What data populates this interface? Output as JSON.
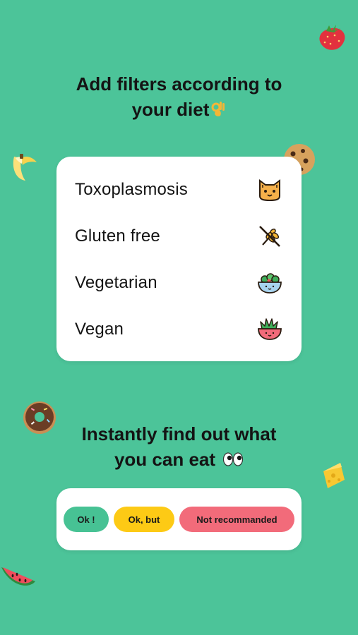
{
  "filters_section": {
    "title_line1": "Add filters according to",
    "title_line2": "your diet",
    "title_emoji": "ok-hand-emoji",
    "items": [
      {
        "label": "Toxoplasmosis",
        "icon": "cat-face-icon"
      },
      {
        "label": "Gluten free",
        "icon": "no-wheat-icon"
      },
      {
        "label": "Vegetarian",
        "icon": "salad-bowl-icon"
      },
      {
        "label": "Vegan",
        "icon": "plant-pot-icon"
      }
    ]
  },
  "results_section": {
    "title_line1": "Instantly find out what",
    "title_line2": "you can eat",
    "title_emoji": "eyes-emoji",
    "badges": [
      {
        "label": "Ok !",
        "color": "#47c294"
      },
      {
        "label": "Ok, but",
        "color": "#fdca15"
      },
      {
        "label": "Not recommanded",
        "color": "#f26b7a"
      }
    ]
  },
  "decorations": [
    "strawberry-icon",
    "banana-icon",
    "cookie-icon",
    "donut-icon",
    "cheese-icon",
    "watermelon-icon"
  ],
  "colors": {
    "background": "#4cc499",
    "card": "#ffffff"
  }
}
